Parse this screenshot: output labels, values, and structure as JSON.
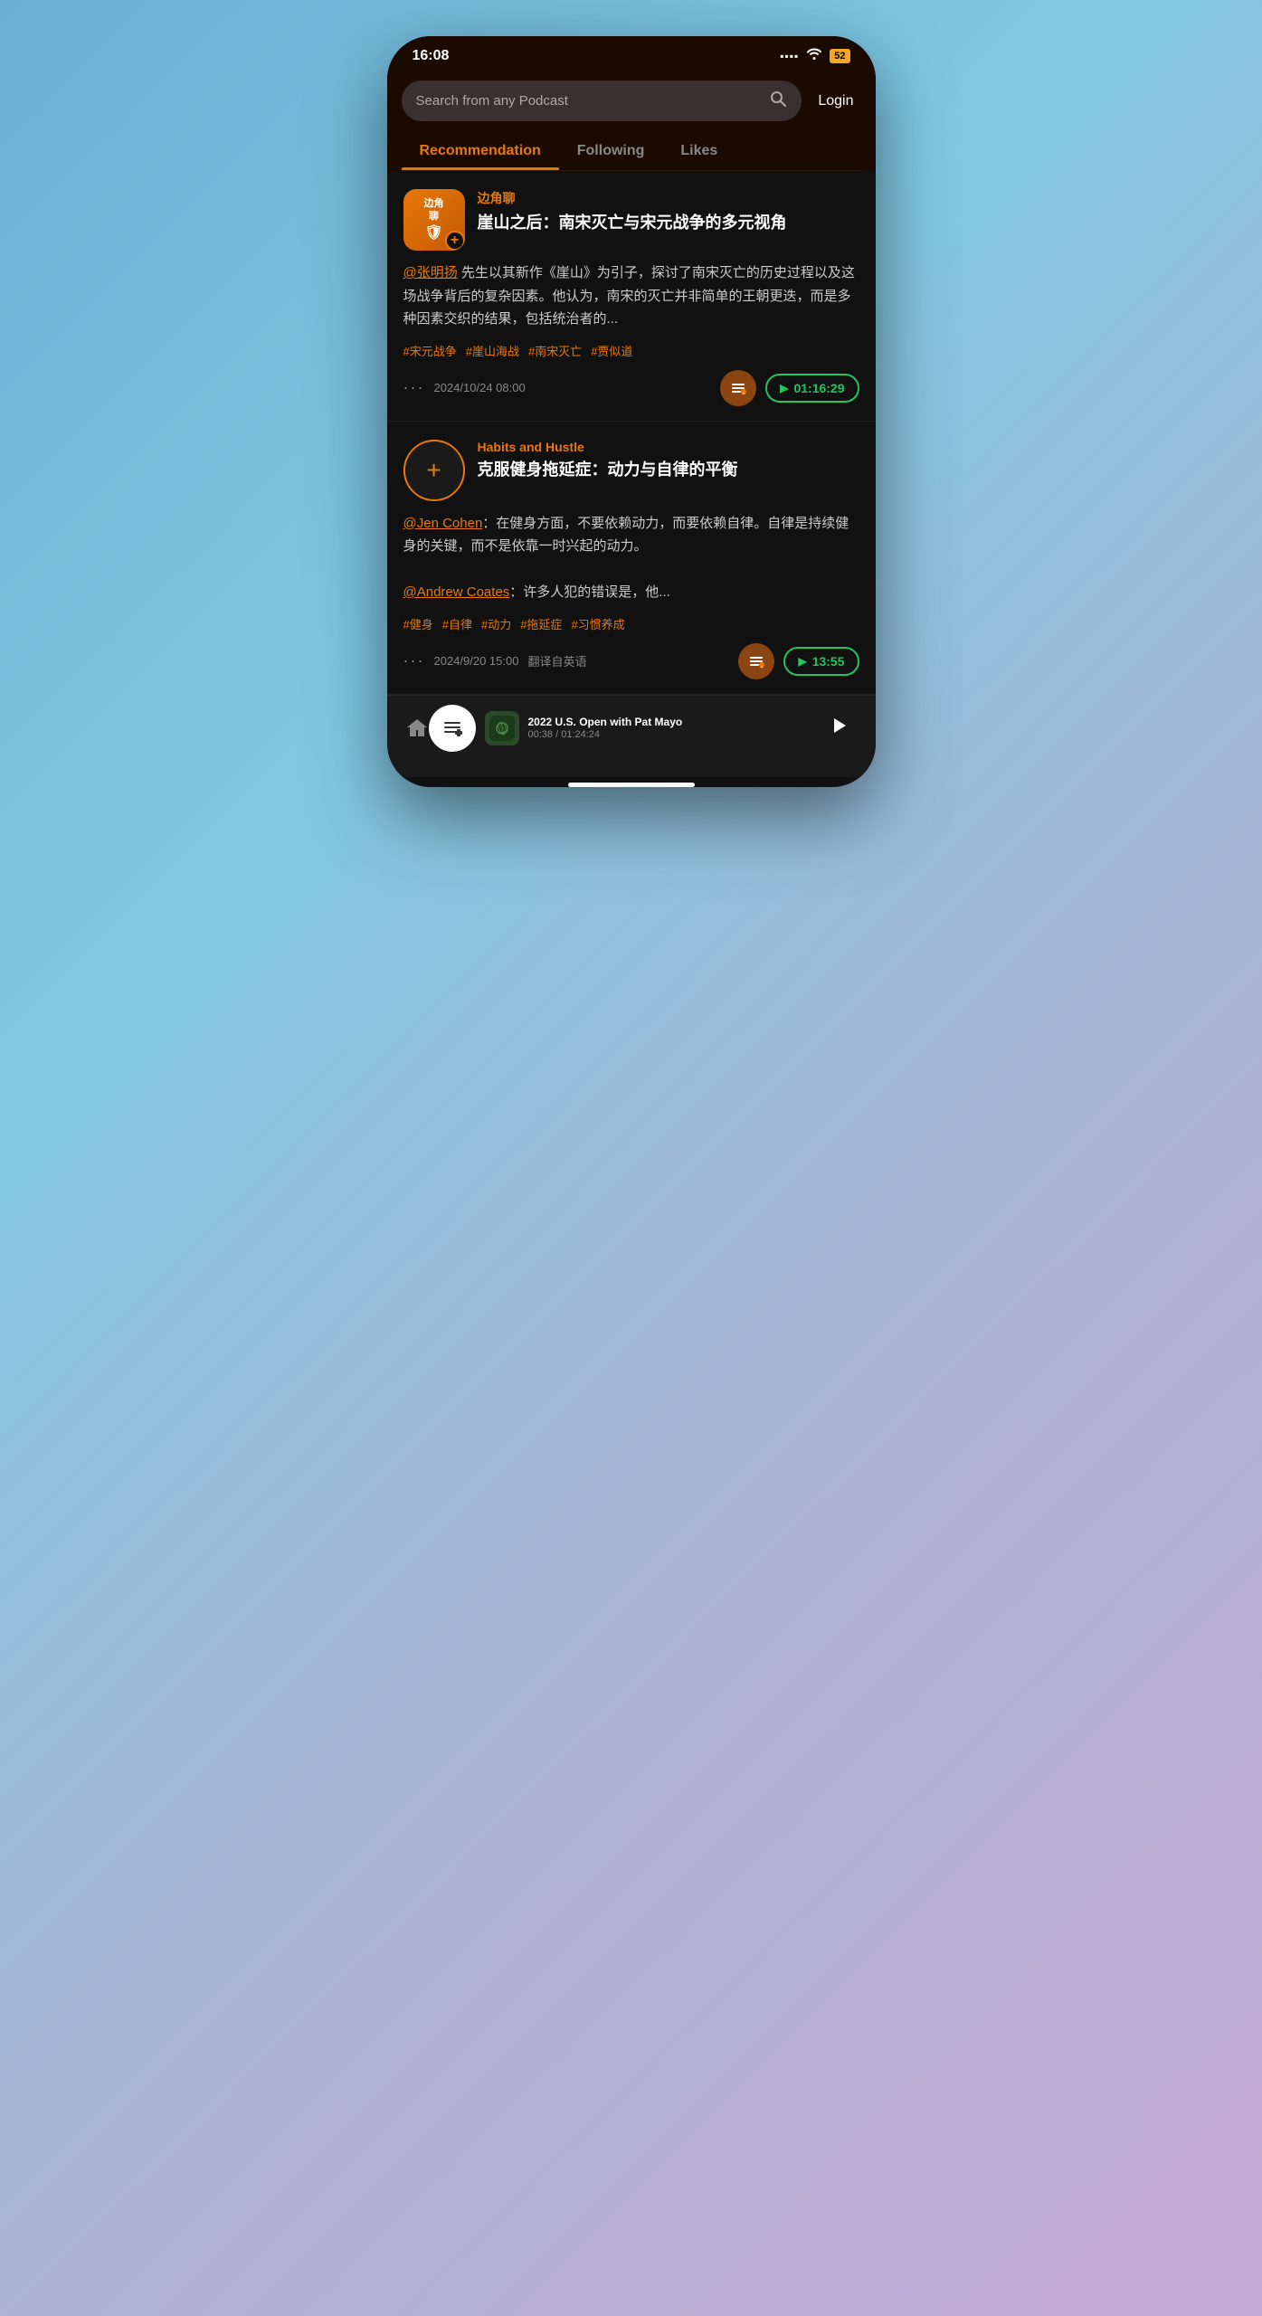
{
  "statusBar": {
    "time": "16:08",
    "battery": "52",
    "signal": "▪▪▪",
    "wifi": "⊛"
  },
  "header": {
    "searchPlaceholder": "Search from any Podcast",
    "searchIcon": "🔍",
    "loginLabel": "Login"
  },
  "tabs": [
    {
      "id": "recommendation",
      "label": "Recommendation",
      "active": true
    },
    {
      "id": "following",
      "label": "Following",
      "active": false
    },
    {
      "id": "likes",
      "label": "Likes",
      "active": false
    }
  ],
  "cards": [
    {
      "id": "card-1",
      "source": "边角聊",
      "thumbLabel1": "边角",
      "thumbLabel2": "聊",
      "title": "崖山之后：南宋灭亡与宋元战争的多元视角",
      "description": "@张明扬 先生以其新作《崖山》为引子，探讨了南宋灭亡的历史过程以及这场战争背后的复杂因素。他认为，南宋的灭亡并非简单的王朝更迭，而是多种因素交织的结果，包括统治者的...",
      "mention": "@张明扬",
      "tags": [
        "#宋元战争",
        "#崖山海战",
        "#南宋灭亡",
        "#贾似道"
      ],
      "timestamp": "2024/10/24 08:00",
      "translateLabel": "",
      "duration": "01:16:29"
    },
    {
      "id": "card-2",
      "source": "Habits and Hustle",
      "thumbLabel1": "+",
      "thumbLabel2": "",
      "title": "克服健身拖延症：动力与自律的平衡",
      "description": "@Jen Cohen：在健身方面，不要依赖动力，而要依赖自律。自律是持续健身的关键，而不是依靠一时兴起的动力。\n\n@Andrew Coates：许多人犯的错误是，他...",
      "mention1": "@Jen Cohen",
      "mention2": "@Andrew Coates",
      "tags": [
        "#健身",
        "#自律",
        "#动力",
        "#拖延症",
        "#习惯养成"
      ],
      "timestamp": "2024/9/20 15:00",
      "translateLabel": "翻译自英语",
      "duration": "13:55"
    }
  ],
  "nowPlaying": {
    "title": "2022 U.S. Open with Pat Mayo",
    "currentTime": "00:38",
    "totalTime": "01:24:24",
    "thumbEmoji": "🎙"
  },
  "nav": {
    "homeIcon": "⌂",
    "libraryIcon": "📋",
    "playIcon": "▷"
  }
}
